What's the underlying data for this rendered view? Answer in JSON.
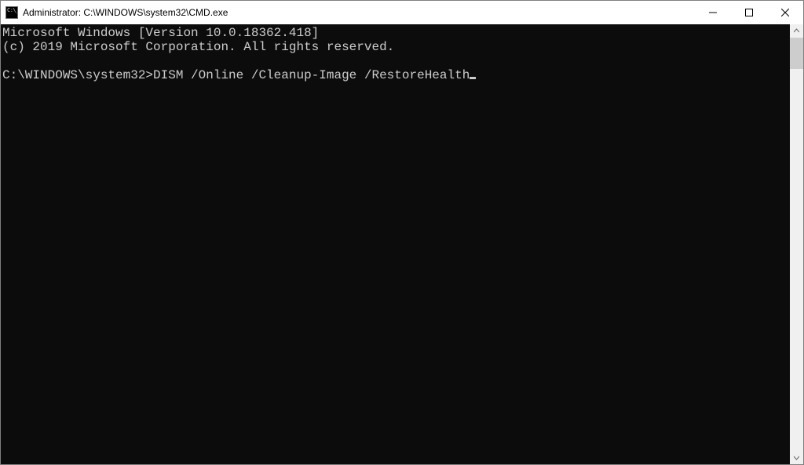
{
  "titlebar": {
    "title": "Administrator: C:\\WINDOWS\\system32\\CMD.exe"
  },
  "terminal": {
    "line1": "Microsoft Windows [Version 10.0.18362.418]",
    "line2": "(c) 2019 Microsoft Corporation. All rights reserved.",
    "blank": "",
    "prompt": "C:\\WINDOWS\\system32>",
    "command": "DISM /Online /Cleanup-Image /RestoreHealth"
  }
}
